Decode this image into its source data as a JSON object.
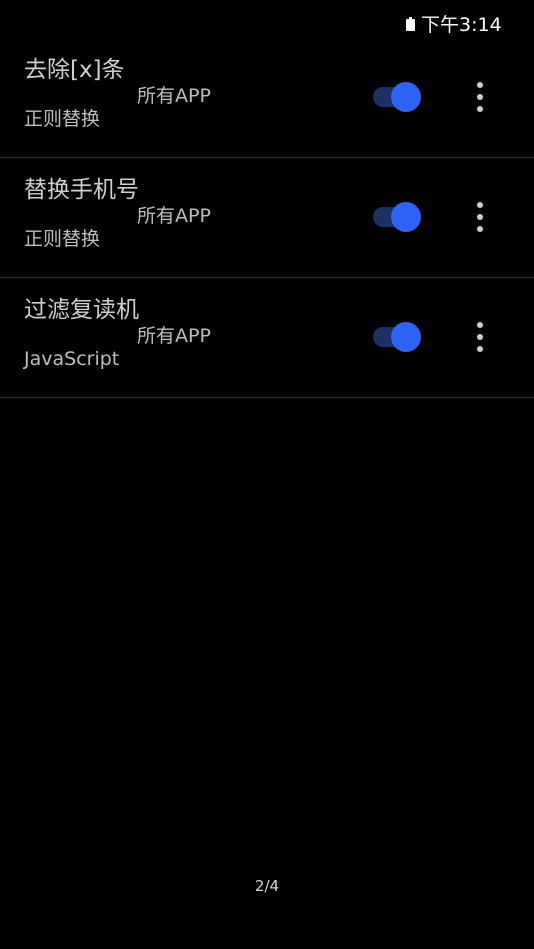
{
  "status_bar": {
    "time": "下午3:14",
    "battery_icon": "battery-icon"
  },
  "rules": [
    {
      "name": "去除[x]条",
      "scope": "所有APP",
      "type": "正则替换",
      "enabled": true
    },
    {
      "name": "替换手机号",
      "scope": "所有APP",
      "type": "正则替换",
      "enabled": true
    },
    {
      "name": "过滤复读机",
      "scope": "所有APP",
      "type": "JavaScript",
      "enabled": true
    }
  ],
  "icons": {
    "toggle": "toggle-switch-on",
    "more": "more-vertical-icon"
  },
  "colors": {
    "background": "#000000",
    "accent": "#2f63f5",
    "toggle_track": "#1d2f63",
    "divider": "#2a2a2a"
  },
  "pager": {
    "label": "2/4"
  }
}
